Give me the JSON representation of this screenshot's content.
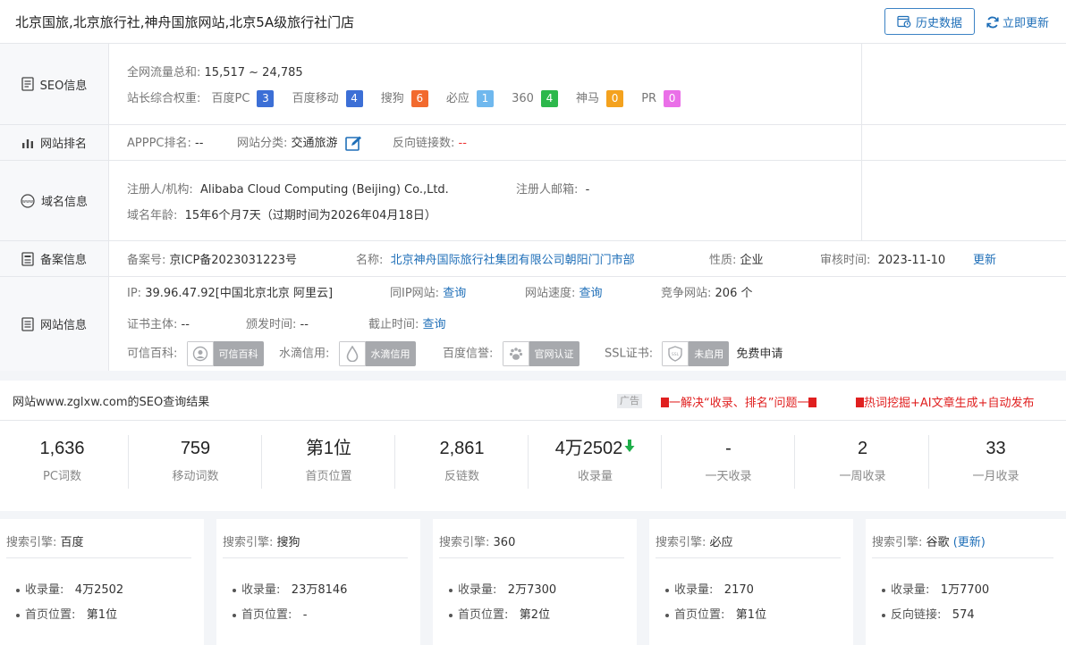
{
  "header": {
    "title": "北京国旅,北京旅行社,神舟国旅网站,北京5A级旅行社门店",
    "history_btn": "历史数据",
    "update_link": "立即更新"
  },
  "seo": {
    "label": "SEO信息",
    "traffic_key": "全网流量总和:",
    "traffic_val": "15,517 ~ 24,785",
    "weight_key": "站长综合权重:",
    "weights": [
      {
        "name": "百度PC",
        "value": "3",
        "color": "#3c6fd6"
      },
      {
        "name": "百度移动",
        "value": "4",
        "color": "#3c6fd6"
      },
      {
        "name": "搜狗",
        "value": "6",
        "color": "#f26a2e"
      },
      {
        "name": "必应",
        "value": "1",
        "color": "#6fb8ee"
      },
      {
        "name": "360",
        "value": "4",
        "color": "#2db84c"
      },
      {
        "name": "神马",
        "value": "0",
        "color": "#f4a21e"
      },
      {
        "name": "PR",
        "value": "0",
        "color": "#ea6fe8"
      }
    ]
  },
  "rank": {
    "label": "网站排名",
    "apppc_key": "APPPC排名:",
    "apppc_val": "--",
    "cat_key": "网站分类:",
    "cat_val": "交通旅游",
    "backlink_key": "反向链接数:",
    "backlink_val": "--"
  },
  "domain": {
    "label": "域名信息",
    "reg_key": "注册人/机构:",
    "reg_val": "Alibaba Cloud Computing (Beijing) Co.,Ltd.",
    "email_key": "注册人邮箱:",
    "email_val": "-",
    "age_key": "域名年龄:",
    "age_val": "15年6个月7天（过期时间为2026年04月18日）"
  },
  "beian": {
    "label": "备案信息",
    "no_key": "备案号:",
    "no_val": "京ICP备2023031223号",
    "name_key": "名称:",
    "name_val": "北京神舟国际旅行社集团有限公司朝阳门门市部",
    "type_key": "性质:",
    "type_val": "企业",
    "audit_key": "审核时间:",
    "audit_val": "2023-11-10",
    "update": "更新"
  },
  "site": {
    "label": "网站信息",
    "ip_key": "IP:",
    "ip_val": "39.96.47.92[中国北京北京 阿里云]",
    "sameip_key": "同IP网站:",
    "sameip_val": "查询",
    "speed_key": "网站速度:",
    "speed_val": "查询",
    "compete_key": "竞争网站:",
    "compete_val": "206 个",
    "cert_key": "证书主体:",
    "cert_val": "--",
    "issue_key": "颁发时间:",
    "issue_val": "--",
    "expire_key": "截止时间:",
    "expire_val": "查询",
    "kexin_key": "可信百科:",
    "kexin_val": "可信百科",
    "shuidi_key": "水滴信用:",
    "shuidi_val": "水滴信用",
    "baidu_key": "百度信誉:",
    "baidu_val": "官网认证",
    "ssl_key": "SSL证书:",
    "ssl_val": "未启用",
    "ssl_apply": "免费申请"
  },
  "result": {
    "title": "网站www.zglxw.com的SEO查询结果",
    "ad_tag": "广告",
    "ad1": "一解决“收录、排名”问题一",
    "ad2": "热词挖掘+AI文章生成+自动发布"
  },
  "stats": [
    {
      "value": "1,636",
      "label": "PC词数"
    },
    {
      "value": "759",
      "label": "移动词数"
    },
    {
      "value": "第1位",
      "label": "首页位置"
    },
    {
      "value": "2,861",
      "label": "反链数"
    },
    {
      "value": "4万2502",
      "label": "收录量"
    },
    {
      "value": "-",
      "label": "一天收录"
    },
    {
      "value": "2",
      "label": "一周收录"
    },
    {
      "value": "33",
      "label": "一月收录"
    }
  ],
  "engines": [
    {
      "key": "搜索引擎:",
      "name": "百度",
      "extra": "",
      "r1k": "收录量:",
      "r1v": "4万2502",
      "r2k": "首页位置:",
      "r2v": "第1位"
    },
    {
      "key": "搜索引擎:",
      "name": "搜狗",
      "extra": "",
      "r1k": "收录量:",
      "r1v": "23万8146",
      "r2k": "首页位置:",
      "r2v": "-"
    },
    {
      "key": "搜索引擎:",
      "name": "360",
      "extra": "",
      "r1k": "收录量:",
      "r1v": "2万7300",
      "r2k": "首页位置:",
      "r2v": "第2位"
    },
    {
      "key": "搜索引擎:",
      "name": "必应",
      "extra": "",
      "r1k": "收录量:",
      "r1v": "2170",
      "r2k": "首页位置:",
      "r2v": "第1位"
    },
    {
      "key": "搜索引擎:",
      "name": "谷歌",
      "extra": "(更新)",
      "r1k": "收录量:",
      "r1v": "1万7700",
      "r2k": "反向链接:",
      "r2v": "574"
    }
  ]
}
